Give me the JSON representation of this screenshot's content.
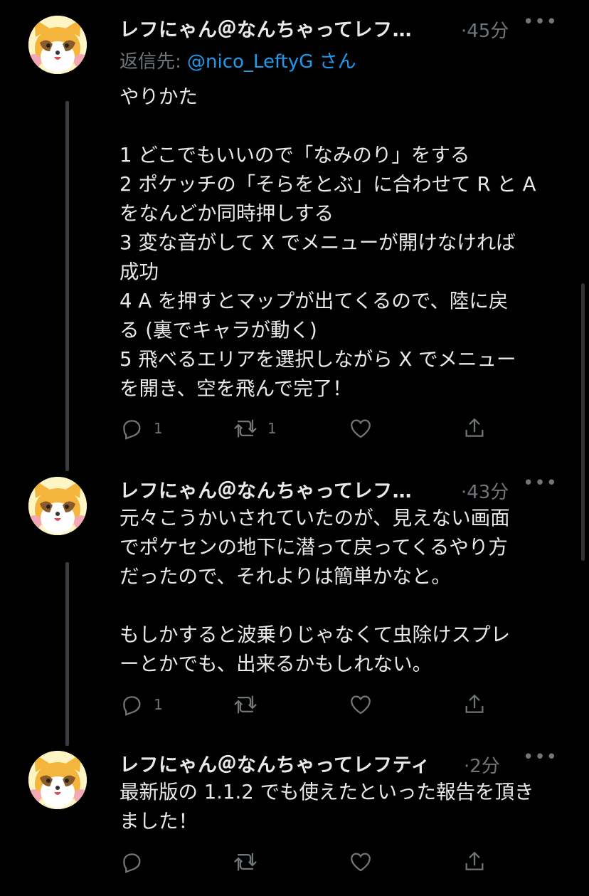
{
  "tweets": [
    {
      "name": "レフにゃん＠なんちゃってレフ…",
      "time": "·45分",
      "more": "•••",
      "reply_prefix": "返信先: ",
      "reply_handle": "@nico_LeftyG",
      "reply_suffix": " さん",
      "lines": [
        "やりかた",
        "",
        "1 どこでもいいので「なみのり」をする",
        "2 ポケッチの「そらをとぶ」に合わせて R と A",
        "をなんどか同時押しする",
        "3 変な音がして X でメニューが開けなければ",
        "成功",
        "4 A を押すとマップが出てくるので、陸に戻",
        "る (裏でキャラが動く)",
        "5 飛べるエリアを選択しながら X でメニュー",
        "を開き、空を飛んで完了！"
      ],
      "reply_count": "1",
      "retweet_count": "1"
    },
    {
      "name": "レフにゃん＠なんちゃってレフ…",
      "time": "·43分",
      "more": "•••",
      "lines": [
        "元々こうかいされていたのが、見えない画面",
        "でポケセンの地下に潜って戻ってくるやり方",
        "だったので、それよりは簡単かなと。",
        "",
        "もしかすると波乗りじゃなくて虫除けスプレ",
        "ーとかでも、出来るかもしれない。"
      ],
      "reply_count": "1",
      "retweet_count": ""
    },
    {
      "name": "レフにゃん＠なんちゃってレフティ",
      "time": "·2分",
      "more": "•••",
      "lines": [
        "最新版の 1.1.2 でも使えたといった報告を頂き",
        "ました！"
      ],
      "reply_count": "",
      "retweet_count": ""
    }
  ],
  "icons": {
    "reply": "reply-icon",
    "retweet": "retweet-icon",
    "like": "heart-icon",
    "share": "share-icon",
    "avatar": "raccoon-avatar"
  },
  "colors": {
    "background": "#000000",
    "text": "#e7e9ea",
    "secondary": "#71767b",
    "link": "#1d9bf0",
    "thread_line": "#3a3d41"
  }
}
